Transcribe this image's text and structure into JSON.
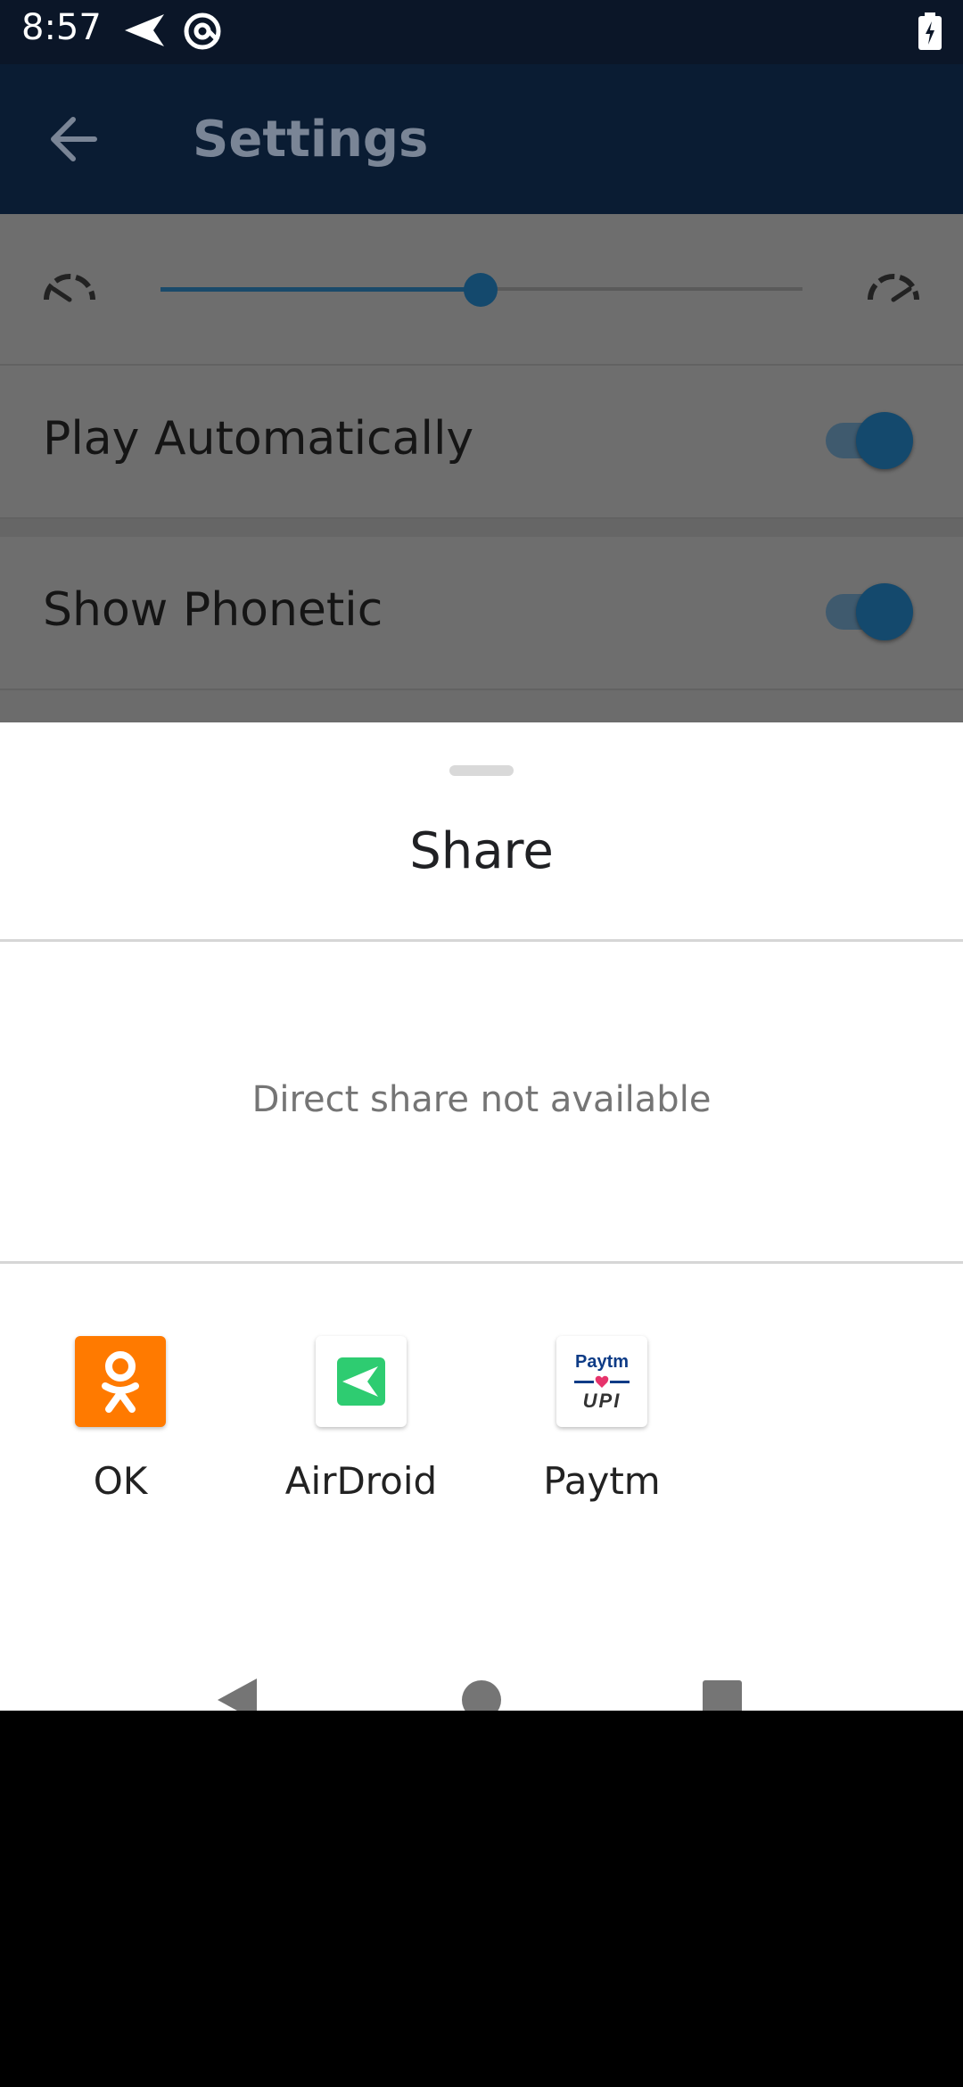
{
  "status_bar": {
    "time": "8:57",
    "icons": [
      "send-icon",
      "at-sign-icon",
      "battery-charging-icon"
    ]
  },
  "app_bar": {
    "title": "Settings",
    "back_icon": "arrow-left-icon"
  },
  "settings": {
    "speed_slider": {
      "value": 0.5,
      "slow_icon": "speedometer-slow-icon",
      "fast_icon": "speedometer-fast-icon"
    },
    "rows": [
      {
        "label": "Play Automatically",
        "on": true
      },
      {
        "label": "Show Phonetic",
        "on": true
      }
    ]
  },
  "share_sheet": {
    "title": "Share",
    "direct_share_message": "Direct share not available",
    "apps": [
      {
        "label": "OK",
        "icon": "odnoklassniki-icon",
        "color": "#ff7a00"
      },
      {
        "label": "AirDroid",
        "icon": "airdroid-icon",
        "color": "#2ecc71"
      },
      {
        "label": "Paytm",
        "icon": "paytm-upi-icon",
        "color": "#0d3b86"
      }
    ],
    "paytm_logo_text": {
      "line1": "Paytm",
      "line2": "UPI"
    }
  },
  "nav_bar": {
    "buttons": [
      "back-triangle-icon",
      "home-circle-icon",
      "recents-square-icon"
    ]
  },
  "colors": {
    "status_bar": "#0b1628",
    "app_bar": "#0a1c33",
    "accent": "#14496d",
    "scrim_content": "#6e6e6e"
  }
}
